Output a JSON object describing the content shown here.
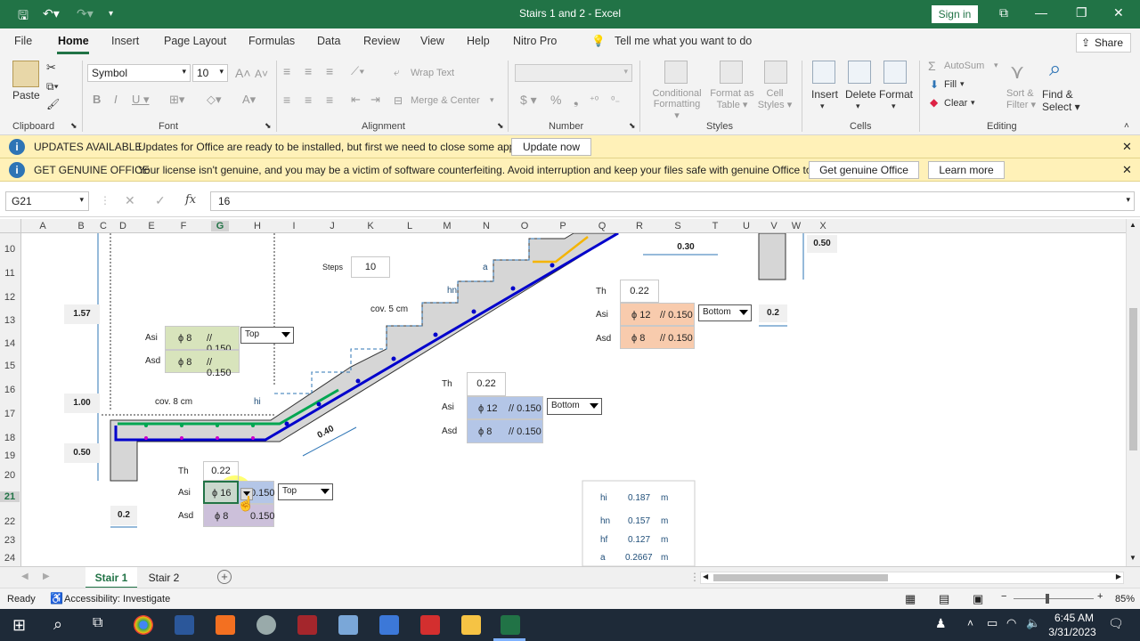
{
  "titlebar": {
    "title": "Stairs 1 and 2  -  Excel",
    "sign_in": "Sign in"
  },
  "menu": {
    "tabs": [
      "File",
      "Home",
      "Insert",
      "Page Layout",
      "Formulas",
      "Data",
      "Review",
      "View",
      "Help",
      "Nitro Pro"
    ],
    "tell_me": "Tell me what you want to do",
    "share": "Share"
  },
  "ribbon": {
    "clipboard": {
      "paste": "Paste",
      "label": "Clipboard"
    },
    "font": {
      "name": "Symbol",
      "size": "10",
      "label": "Font"
    },
    "alignment": {
      "wrap_text": "Wrap Text",
      "merge_center": "Merge & Center",
      "label": "Alignment"
    },
    "number": {
      "label": "Number"
    },
    "styles": {
      "conditional": "Conditional\nFormatting",
      "format_table": "Format as\nTable",
      "cell_styles": "Cell\nStyles",
      "label": "Styles"
    },
    "cells": {
      "insert": "Insert",
      "delete": "Delete",
      "format": "Format",
      "label": "Cells"
    },
    "editing": {
      "autosum": "AutoSum",
      "fill": "Fill",
      "clear": "Clear",
      "sort_filter": "Sort &\nFilter",
      "find_select": "Find &\nSelect",
      "label": "Editing"
    }
  },
  "notices": {
    "updates": {
      "head": "UPDATES AVAILABLE",
      "message": "Updates for Office are ready to be installed, but first we need to close some apps.",
      "button": "Update now"
    },
    "genuine": {
      "head": "GET GENUINE OFFICE",
      "message": "Your license isn't genuine, and you may be a victim of software counterfeiting. Avoid interruption and keep your files safe with genuine Office today.",
      "button": "Get genuine Office",
      "button2": "Learn more"
    }
  },
  "formula_bar": {
    "name_box": "G21",
    "value": "16"
  },
  "columns": [
    "A",
    "B",
    "C",
    "D",
    "E",
    "F",
    "G",
    "H",
    "I",
    "J",
    "K",
    "L",
    "M",
    "N",
    "O",
    "P",
    "Q",
    "R",
    "S",
    "T",
    "U",
    "V",
    "W",
    "X"
  ],
  "rows": [
    "10",
    "11",
    "12",
    "13",
    "14",
    "15",
    "16",
    "17",
    "18",
    "19",
    "20",
    "21",
    "22",
    "23",
    "24"
  ],
  "sheet": {
    "dim_157": "1.57",
    "dim_100": "1.00",
    "dim_050": "0.50",
    "dim_02a": "0.2",
    "dim_030": "0.30",
    "dim_050b": "0.50",
    "dim_02b": "0.2",
    "dim_040": "0.40",
    "steps_label": "Steps",
    "steps_value": "10",
    "cov5": "cov. 5 cm",
    "cov8": "cov. 8 cm",
    "lbl_a": "a",
    "lbl_hn": "hn",
    "lbl_hi": "hi",
    "th_label": "Th",
    "asi_label": "Asi",
    "asd_label": "Asd",
    "blockA": {
      "asi_bar": "ϕ 8",
      "asi_sp": "// 0.150",
      "asd_bar": "ϕ 8",
      "asd_sp": "// 0.150",
      "pos": "Top"
    },
    "blockB": {
      "th": "0.22",
      "asi_bar": "ϕ 12",
      "asi_sp": "// 0.150",
      "asd_bar": "ϕ 8",
      "asd_sp": "// 0.150",
      "pos": "Bottom"
    },
    "blockC": {
      "th": "0.22",
      "asi_bar": "ϕ 12",
      "asi_sp": "// 0.150",
      "asd_bar": "ϕ 8",
      "asd_sp": "// 0.150",
      "pos": "Bottom"
    },
    "blockD": {
      "th": "0.22",
      "asi_bar": "ϕ 16",
      "asi_sp": "0.150",
      "asd_bar": "ϕ 8",
      "asd_sp": "0.150",
      "pos": "Top"
    },
    "results": [
      {
        "name": "hi",
        "value": "0.187",
        "unit": "m"
      },
      {
        "name": "hn",
        "value": "0.157",
        "unit": "m"
      },
      {
        "name": "hf",
        "value": "0.127",
        "unit": "m"
      },
      {
        "name": "a",
        "value": "0.2667",
        "unit": "m"
      }
    ]
  },
  "sheet_tabs": [
    "Stair 1",
    "Stair 2"
  ],
  "status": {
    "ready": "Ready",
    "accessibility": "Accessibility: Investigate",
    "zoom": "85%"
  },
  "taskbar": {
    "time": "6:45 AM",
    "date": "3/31/2023"
  },
  "colors": {
    "excel_green": "#217346",
    "notice_bg": "#fff1b8",
    "green_fill": "#d8e4bc",
    "orange_fill": "#f8cbad",
    "blue_fill": "#b4c6e7",
    "purple_fill": "#ccc0da",
    "rebar_blue": "#0000cc",
    "rebar_green": "#00a651"
  }
}
